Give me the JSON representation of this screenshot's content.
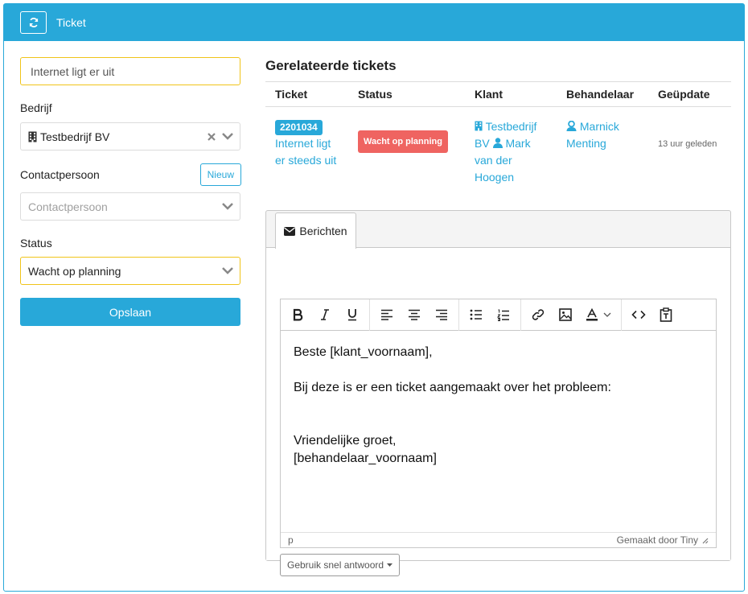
{
  "window": {
    "title": "Ticket"
  },
  "form": {
    "subject_value": "Internet ligt er uit",
    "company_label": "Bedrijf",
    "company_value": "Testbedrijf BV",
    "contact_label": "Contactpersoon",
    "contact_new_label": "Nieuw",
    "contact_placeholder": "Contactpersoon",
    "status_label": "Status",
    "status_value": "Wacht op planning",
    "save_label": "Opslaan"
  },
  "related": {
    "title": "Gerelateerde tickets",
    "columns": [
      "Ticket",
      "Status",
      "Klant",
      "Behandelaar",
      "Geüpdate"
    ],
    "rows": [
      {
        "ticket_no": "2201034",
        "ticket_subject": "Internet ligt er steeds uit",
        "status": "Wacht op planning",
        "company": "Testbedrijf BV",
        "contact": "Mark van der Hoogen",
        "handler": "Marnick Menting",
        "updated": "13 uur geleden"
      }
    ]
  },
  "messages": {
    "tab_label": "Berichten",
    "editor_lines": [
      "Beste [klant_voornaam],",
      "",
      "Bij deze is er een ticket aangemaakt over het probleem:",
      "",
      "",
      "Vriendelijke groet,",
      "[behandelaar_voornaam]"
    ],
    "status_path": "p",
    "powered_by": "Gemaakt door Tiny",
    "quick_reply_label": "Gebruik snel antwoord"
  },
  "colors": {
    "accent": "#28a8d9",
    "warning_border": "#f0c419",
    "status_badge": "#ef6461"
  }
}
